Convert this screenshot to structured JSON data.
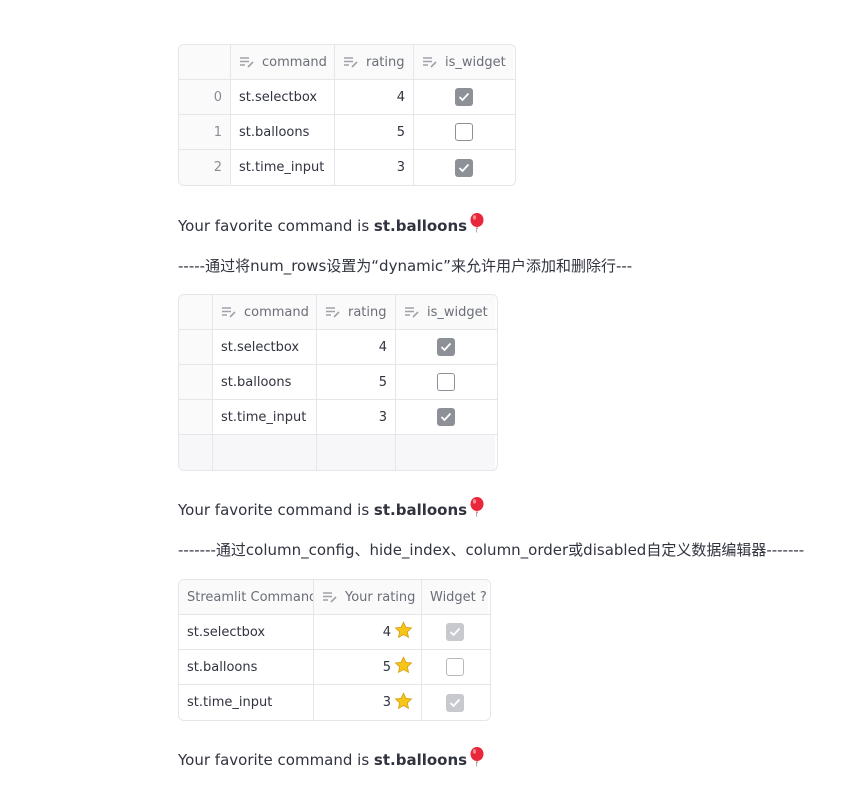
{
  "table1": {
    "headers": [
      "command",
      "rating",
      "is_widget"
    ],
    "rows": [
      {
        "index": "0",
        "command": "st.selectbox",
        "rating": "4",
        "is_widget": true
      },
      {
        "index": "1",
        "command": "st.balloons",
        "rating": "5",
        "is_widget": false
      },
      {
        "index": "2",
        "command": "st.time_input",
        "rating": "3",
        "is_widget": true
      }
    ]
  },
  "favorite1": {
    "prefix": "Your favorite command is ",
    "command": "st.balloons"
  },
  "divider1": "-----通过将num_rows设置为“dynamic”来允许用户添加和删除行---",
  "table2": {
    "headers": [
      "command",
      "rating",
      "is_widget"
    ],
    "rows": [
      {
        "command": "st.selectbox",
        "rating": "4",
        "is_widget": true
      },
      {
        "command": "st.balloons",
        "rating": "5",
        "is_widget": false
      },
      {
        "command": "st.time_input",
        "rating": "3",
        "is_widget": true
      }
    ]
  },
  "favorite2": {
    "prefix": "Your favorite command is ",
    "command": "st.balloons"
  },
  "divider2": "-------通过column_config、hide_index、column_order或disabled自定义数据编辑器-------",
  "table3": {
    "headers": [
      "Streamlit Command",
      "Your rating",
      "Widget ?"
    ],
    "rows": [
      {
        "command": "st.selectbox",
        "rating": "4",
        "is_widget": true
      },
      {
        "command": "st.balloons",
        "rating": "5",
        "is_widget": false
      },
      {
        "command": "st.time_input",
        "rating": "3",
        "is_widget": true
      }
    ]
  },
  "favorite3": {
    "prefix": "Your favorite command is ",
    "command": "st.balloons"
  },
  "icons": {
    "edit": "edit-column-icon",
    "check": "checkmark-icon",
    "star": "star-icon",
    "balloon": "balloon-icon"
  },
  "colors": {
    "text": "#31333f",
    "border": "#e6e6ea",
    "checkbox": "#8e9098",
    "balloon": "#e8283a",
    "star": "#f5c518"
  }
}
